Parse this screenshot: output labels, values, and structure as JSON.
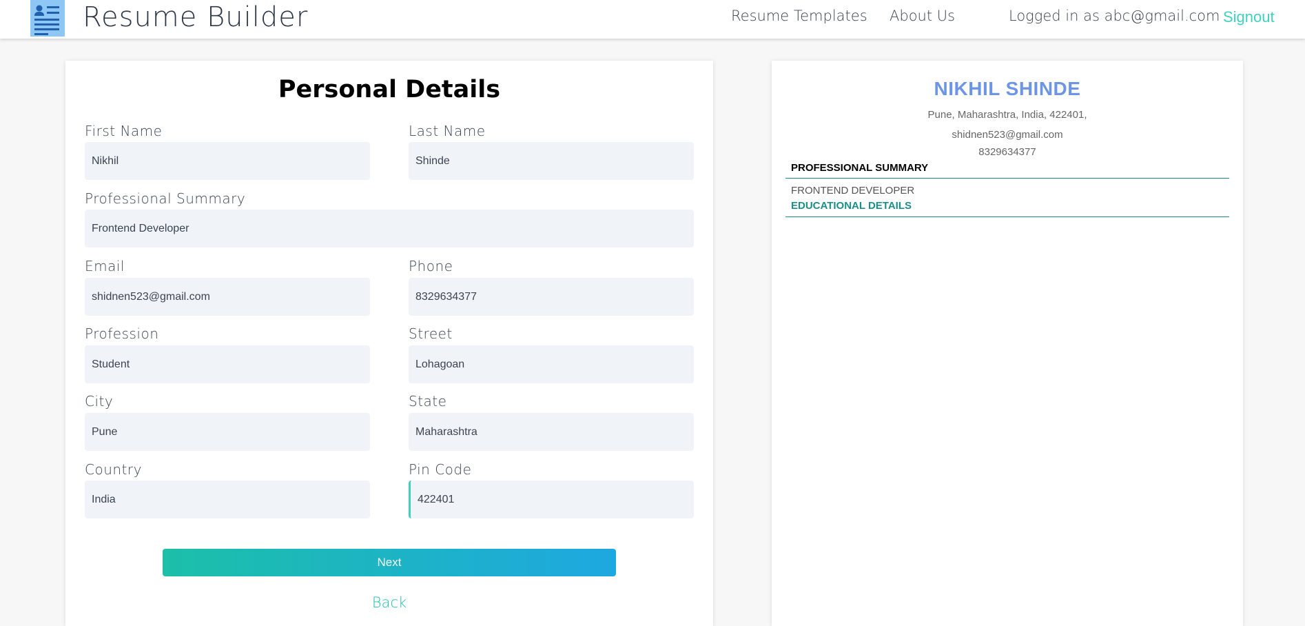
{
  "nav": {
    "logo_icon": "resume-document-icon",
    "brand": "Resume Builder",
    "links": [
      "Resume Templates",
      "About Us"
    ],
    "logged_in": "Logged in as abc@gmail.com",
    "signout": "Signout",
    "accent_color": "#3fd1c0"
  },
  "form": {
    "title": "Personal Details",
    "fields": [
      {
        "label": "First Name",
        "value": "Nikhil"
      },
      {
        "label": "Last Name",
        "value": "Shinde"
      },
      {
        "label": "Professional Summary",
        "value": "Frontend Developer"
      },
      {
        "label": "Email",
        "value": "shidnen523@gmail.com"
      },
      {
        "label": "Phone",
        "value": "8329634377"
      },
      {
        "label": "Profession",
        "value": "Student"
      },
      {
        "label": "Street",
        "value": "Lohagoan"
      },
      {
        "label": "City",
        "value": "Pune"
      },
      {
        "label": "State",
        "value": "Maharashtra"
      },
      {
        "label": "Country",
        "value": "India"
      },
      {
        "label": "Pin Code",
        "value": "422401"
      }
    ],
    "next_label": "Next",
    "back_label": "Back",
    "button_gradient": [
      "#1cbfa9",
      "#1ea8e0"
    ]
  },
  "preview": {
    "name": "NIKHIL SHINDE",
    "address": "Pune, Maharashtra, India, 422401,",
    "email": "shidnen523@gmail.com",
    "phone": "8329634377",
    "summary_heading": "PROFESSIONAL SUMMARY",
    "summary_text": "FRONTEND DEVELOPER",
    "education_heading": "EDUCATIONAL DETAILS",
    "name_color": "#6d95e6",
    "section_color": "#1a8f87"
  }
}
